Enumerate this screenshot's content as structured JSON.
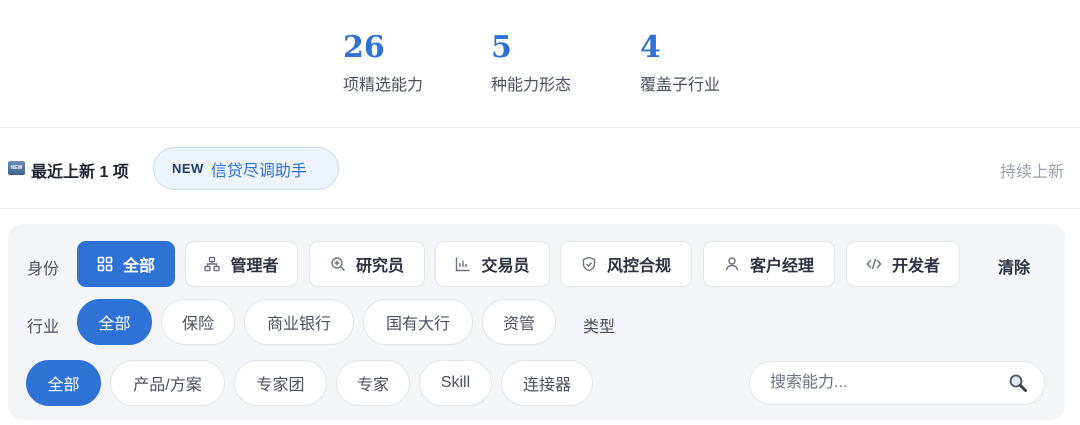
{
  "stats": [
    {
      "value": "26",
      "label": "项精选能力"
    },
    {
      "value": "5",
      "label": "种能力形态"
    },
    {
      "value": "4",
      "label": "覆盖子行业"
    }
  ],
  "recent": {
    "icon_text": "NEW",
    "label": "最近上新 1 项",
    "chip_badge": "NEW",
    "chip_title": "信贷尽调助手",
    "right_text": "持续上新"
  },
  "filters": {
    "identity": {
      "label": "身份",
      "options": [
        {
          "label": "全部",
          "icon": "grid-icon",
          "active": true
        },
        {
          "label": "管理者",
          "icon": "org-chart-icon",
          "active": false
        },
        {
          "label": "研究员",
          "icon": "zoom-in-icon",
          "active": false
        },
        {
          "label": "交易员",
          "icon": "bar-chart-icon",
          "active": false
        },
        {
          "label": "风控合规",
          "icon": "shield-icon",
          "active": false
        },
        {
          "label": "客户经理",
          "icon": "user-icon",
          "active": false
        },
        {
          "label": "开发者",
          "icon": "code-icon",
          "active": false
        }
      ],
      "clear": "清除"
    },
    "industry": {
      "label": "行业",
      "options": [
        {
          "label": "全部",
          "active": true
        },
        {
          "label": "保险",
          "active": false
        },
        {
          "label": "商业银行",
          "active": false
        },
        {
          "label": "国有大行",
          "active": false
        },
        {
          "label": "资管",
          "active": false
        }
      ],
      "type_label": "类型"
    },
    "type": {
      "options": [
        {
          "label": "全部",
          "active": true
        },
        {
          "label": "产品/方案",
          "active": false
        },
        {
          "label": "专家团",
          "active": false
        },
        {
          "label": "专家",
          "active": false
        },
        {
          "label": "Skill",
          "active": false
        },
        {
          "label": "连接器",
          "active": false
        }
      ]
    },
    "search": {
      "placeholder": "搜索能力...",
      "value": "",
      "icon": "magnifier-icon"
    }
  },
  "colors": {
    "accent": "#2f72d6",
    "panel": "#f3f5f8",
    "chip_bg": "#eef4fd"
  }
}
